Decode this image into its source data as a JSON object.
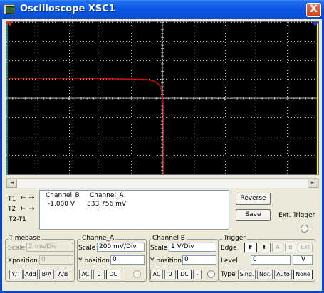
{
  "window": {
    "title": "Oscilloscope XSC1",
    "close_label": "X"
  },
  "screen": {
    "background": "#000000",
    "grid_color": "#b0b0b0",
    "trace_color": "#cc1111",
    "cursor1_color": "#00e0e0",
    "cursor2_color": "#ffff00"
  },
  "scroll": {
    "left_arrow": "◄",
    "right_arrow": "►"
  },
  "cursors": {
    "t1_label": "T1",
    "t2_label": "T2",
    "t2t1_label": "T2-T1",
    "left_arrow": "←",
    "right_arrow": "→"
  },
  "readout": {
    "channel_b_header": "Channel_B",
    "channel_a_header": "Channel_A",
    "channel_b_value": "-1.000 V",
    "channel_a_value": "833.756 mV"
  },
  "buttons": {
    "reverse": "Reverse",
    "save": "Save",
    "ext_trigger": "Ext. Trigger"
  },
  "timebase": {
    "title": "Timebase",
    "scale_label": "Scale",
    "scale_value": "2 ms/Div",
    "xpos_label": "Xposition",
    "xpos_value": "0",
    "mode_yt": "Y/T",
    "mode_add": "Add",
    "mode_ba": "B/A",
    "mode_ab": "A/B"
  },
  "channel_a": {
    "title": "Channe_A",
    "scale_label": "Scale",
    "scale_value": "200 mV/Div",
    "ypos_label": "Y position",
    "ypos_value": "0",
    "ac": "AC",
    "zero": "0",
    "dc": "DC"
  },
  "channel_b": {
    "title": "Channel B",
    "scale_label": "Scale",
    "scale_value": "1  V/Div",
    "ypos_label": "Y position",
    "ypos_value": "0",
    "ac": "AC",
    "zero": "0",
    "dc": "DC",
    "minus": "-"
  },
  "trigger": {
    "title": "Trigger",
    "edge_label": "Edge",
    "edge_rise": "F",
    "edge_fall": "ł",
    "src_a": "A",
    "src_b": "B",
    "src_ext": "Ext",
    "level_label": "Level",
    "level_value": "0",
    "level_unit": "V",
    "type_label": "Type",
    "type_sing": "Sing.",
    "type_nor": "Nor.",
    "type_auto": "Auto",
    "type_none": "None"
  }
}
